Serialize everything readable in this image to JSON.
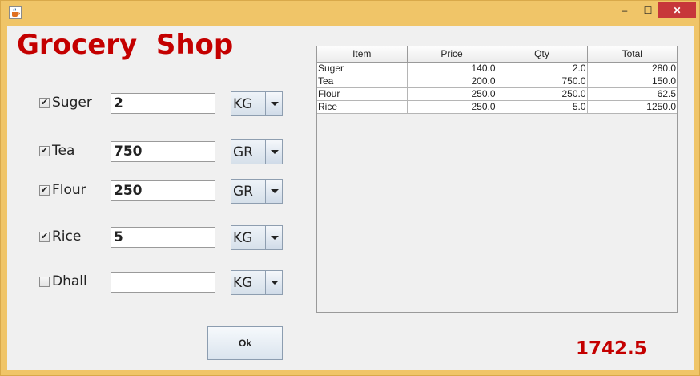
{
  "window": {
    "icon": "java-cup-icon",
    "controls": {
      "minimize": "‒",
      "maximize": "☐",
      "close": "✕"
    }
  },
  "app": {
    "title": "Grocery  Shop"
  },
  "items": [
    {
      "name": "Suger",
      "checked": true,
      "quantity": "2",
      "unit": "KG"
    },
    {
      "name": "Tea",
      "checked": true,
      "quantity": "750",
      "unit": "GR"
    },
    {
      "name": "Flour",
      "checked": true,
      "quantity": "250",
      "unit": "GR"
    },
    {
      "name": "Rice",
      "checked": true,
      "quantity": "5",
      "unit": "KG"
    },
    {
      "name": "Dhall",
      "checked": false,
      "quantity": "",
      "unit": "KG"
    }
  ],
  "table": {
    "headers": [
      "Item",
      "Price",
      "Qty",
      "Total"
    ],
    "rows": [
      [
        "Suger",
        "140.0",
        "2.0",
        "280.0"
      ],
      [
        "Tea",
        "200.0",
        "750.0",
        "150.0"
      ],
      [
        "Flour",
        "250.0",
        "250.0",
        "62.5"
      ],
      [
        "Rice",
        "250.0",
        "5.0",
        "1250.0"
      ]
    ]
  },
  "ok_label": "Ok",
  "grand_total": "1742.5",
  "colors": {
    "title": "#c40000",
    "total": "#c40000",
    "frame": "#f0c568",
    "close_button": "#c7373a"
  }
}
